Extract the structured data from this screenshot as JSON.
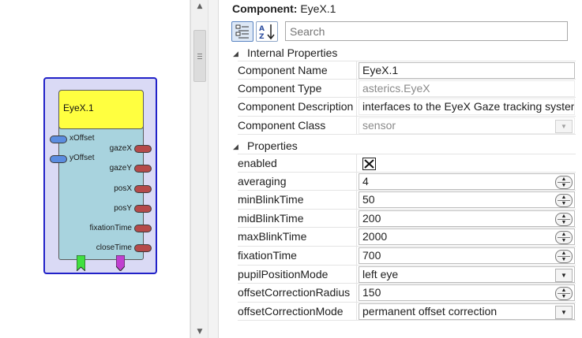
{
  "canvas": {
    "component": {
      "title": "EyeX.1",
      "inputs": [
        "xOffset",
        "yOffset"
      ],
      "outputs": [
        "gazeX",
        "gazeY",
        "posX",
        "posY",
        "fixationTime",
        "closeTime"
      ]
    }
  },
  "panel": {
    "header_label": "Component",
    "header_value": "EyeX.1",
    "search_placeholder": "Search",
    "categories": {
      "internal": "Internal Properties",
      "properties": "Properties"
    },
    "internal_rows": [
      {
        "name": "Component Name",
        "value": "EyeX.1"
      },
      {
        "name": "Component Type",
        "value": "asterics.EyeX"
      },
      {
        "name": "Component Description",
        "value": "interfaces to the EyeX Gaze tracking system"
      },
      {
        "name": "Component Class",
        "value": "sensor"
      }
    ],
    "property_rows": [
      {
        "name": "enabled",
        "value": ""
      },
      {
        "name": "averaging",
        "value": "4"
      },
      {
        "name": "minBlinkTime",
        "value": "50"
      },
      {
        "name": "midBlinkTime",
        "value": "200"
      },
      {
        "name": "maxBlinkTime",
        "value": "2000"
      },
      {
        "name": "fixationTime",
        "value": "700"
      },
      {
        "name": "pupilPositionMode",
        "value": "left eye"
      },
      {
        "name": "offsetCorrectionRadius",
        "value": "150"
      },
      {
        "name": "offsetCorrectionMode",
        "value": "permanent offset correction"
      }
    ]
  },
  "colors": {
    "component_border": "#2121c8",
    "component_title": "#ffff40",
    "component_body": "#a8d3de",
    "input_port": "#5b8de0",
    "output_port": "#b54a4a",
    "event_in": "#40e040",
    "event_out": "#c040d0"
  }
}
